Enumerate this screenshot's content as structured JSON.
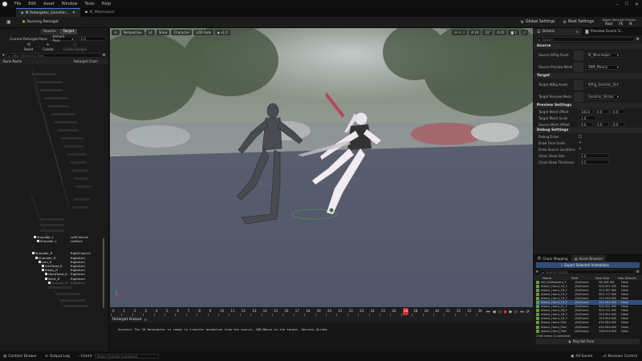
{
  "menu": [
    "File",
    "Edit",
    "Asset",
    "Window",
    "Tools",
    "Help"
  ],
  "tabs": [
    {
      "label": "IK Retargeter_Genshin..."
    },
    {
      "label": "IK_Mannequin"
    }
  ],
  "toolbar": {
    "running_retarget": "Running Retarget",
    "global_settings": "Global Settings",
    "root_settings": "Root Settings",
    "toggle_phase": "Toggle Retarget Phases",
    "phase_root": "Root",
    "phase_fk": "FK",
    "phase_ik": "IK"
  },
  "left": {
    "source_tab": "Source",
    "target_tab": "Target",
    "current_pose_label": "Current Retarget Pose:",
    "current_pose_value": "Default Pose",
    "pose_value2": "1.0",
    "reset": "Reset",
    "create": "Create",
    "create_sample": "Create Sample",
    "filter_placeholder": "Filter Hierarchy Tree...",
    "col_bone": "Bone Name",
    "col_chain": "Retarget Chain",
    "bones": [
      {
        "name": "Shoulder_L",
        "chain": "LeftClavicle",
        "lvl": 1
      },
      {
        "name": "Shoulder_L",
        "chain": "LeftArm",
        "lvl": 2
      },
      {
        "name": "Shoulder_R",
        "chain": "RightClavicle",
        "lvl": 1
      },
      {
        "name": "Shoulder_R",
        "chain": "RightArm",
        "lvl": 2
      },
      {
        "name": "Arm_R",
        "chain": "RightArm",
        "lvl": 3
      },
      {
        "name": "ArmTwist_R",
        "chain": "RightArm",
        "lvl": 4
      },
      {
        "name": "Elbow_R",
        "chain": "RightArm",
        "lvl": 4
      },
      {
        "name": "HandTwist_R",
        "chain": "RightArm",
        "lvl": 5
      },
      {
        "name": "Wrist_R",
        "chain": "RightArm",
        "lvl": 5
      },
      {
        "name": "Thumb1_R",
        "chain": "RightArm",
        "lvl": 6
      }
    ]
  },
  "viewport": {
    "perspective": "Perspective",
    "lit": "Lit",
    "show": "Show",
    "character": "Character",
    "lod": "LOD Auto",
    "speed": "x1.0",
    "grid_snap": "10",
    "angle_snap": "10°",
    "scale_snap": "0.25",
    "cam_speed": "1"
  },
  "timeline": {
    "frames": [
      "0",
      "1",
      "2",
      "3",
      "4",
      "5",
      "6",
      "7",
      "8",
      "9",
      "10",
      "11",
      "12",
      "13",
      "14",
      "15",
      "16",
      "17",
      "18",
      "19",
      "20",
      "21",
      "22",
      "23",
      "24",
      "25",
      "26",
      "27",
      "28",
      "29",
      "30",
      "31",
      "32",
      "33",
      "34"
    ],
    "current_frame": "28"
  },
  "output": {
    "tab": "Retarget Output",
    "message": "Success! The IK Retargeter is ready to transfer animation from the source, SKM_Manny to the target, Genshin_Shinko"
  },
  "right": {
    "details_tab": "Details",
    "preview_tab": "Preview Scene S...",
    "search_placeholder": "Search",
    "source_section": "Source",
    "source_ik_label": "Source IKRig Asset",
    "source_ik_value": "IK_Mannequin",
    "source_mesh_label": "Source Preview Mesh",
    "source_mesh_value": "SKM_Manny",
    "target_section": "Target",
    "target_ik_label": "Target IKRig Asset",
    "target_ik_value": "IKRig_Genshin_Shinko",
    "target_mesh_label": "Target Preview Mesh",
    "target_mesh_value": "Genshin_Shinko",
    "preview_section": "Preview Settings",
    "target_offset_label": "Target Mesh Offset",
    "target_offset": [
      "100.0",
      "0.0",
      "0.0"
    ],
    "target_scale_label": "Target Mesh Scale",
    "target_scale": "1.0",
    "source_offset_label": "Source Mesh Offset",
    "source_offset": [
      "0.0",
      "0.0",
      "0.0"
    ],
    "debug_section": "Debug Settings",
    "debug_draw_label": "Debug Draw",
    "draw_final_goals": "Draw Final Goals",
    "draw_source_locations": "Draw Source Locations",
    "chain_draw_size_label": "Chain Draw Size",
    "chain_draw_size": "5.0",
    "chain_draw_thickness_label": "Chain Draw Thickness",
    "chain_draw_thickness": "0.5",
    "chain_mapping_tab": "Chain Mapping",
    "asset_browser_tab": "Asset Browser",
    "export_button": "Export Selected Animations",
    "asset_search": "Search Assets",
    "col_name": "Name",
    "col_path": "Path",
    "col_size": "Disk Size",
    "col_virtual": "Has Virtuals",
    "assets": [
      {
        "name": "AM_FollMaestro_F",
        "path": "/All/Game",
        "size": "28.436 KiB",
        "virt": "False"
      },
      {
        "name": "Attack_Hand_1R_F",
        "path": "/All/Game",
        "size": "505.051 KiB",
        "virt": "False"
      },
      {
        "name": "Attack_Hand_1R_F",
        "path": "/All/Game",
        "size": "153.787 KiB",
        "virt": "False"
      },
      {
        "name": "Attack_Hand_1R_F",
        "path": "/All/Game",
        "size": "305.177 KiB",
        "virt": "False"
      },
      {
        "name": "Attack_Hand_1R_F",
        "path": "/All/Game",
        "size": "154.263 KiB",
        "virt": "False"
      },
      {
        "name": "Attack_Hand_1R_F",
        "path": "/All/Game",
        "size": "154.962 KiB",
        "virt": "False"
      },
      {
        "name": "Attack_Hand_2L_F",
        "path": "/All/Game",
        "size": "305.031 KiB",
        "virt": "False"
      },
      {
        "name": "Attack_Hand_2R_F",
        "path": "/All/Game",
        "size": "303.731 KiB",
        "virt": "False"
      },
      {
        "name": "Attack_Hand_1R_F",
        "path": "/All/Game",
        "size": "154.901 KiB",
        "virt": "False"
      },
      {
        "name": "Attack_Hand_1R_F",
        "path": "/All/Game",
        "size": "153.954 KiB",
        "virt": "False"
      },
      {
        "name": "Attack_Hand_Pistl",
        "path": "/All/Game",
        "size": "430.584 KiB",
        "virt": "False"
      },
      {
        "name": "Attack_Hand_Pistl",
        "path": "/All/Game",
        "size": "430.584 KiB",
        "virt": "False"
      },
      {
        "name": "Attack_Hand_Pistl",
        "path": "/All/Game",
        "size": "158.519 KiB",
        "virt": "False"
      }
    ],
    "items_count": "2381 items (1 selected)",
    "play_ref_pose": "Play Ref Pose"
  },
  "status": {
    "content_drawer": "Content Drawer",
    "output_log": "Output Log",
    "cmd": "Cmd",
    "console_placeholder": "Enter Console Command",
    "all_saved": "All Saved",
    "revision_control": "Revision Control"
  },
  "colors": {
    "accent": "#3a7bd5",
    "selected_row": "#2f4f7a",
    "playhead": "#c03030"
  }
}
